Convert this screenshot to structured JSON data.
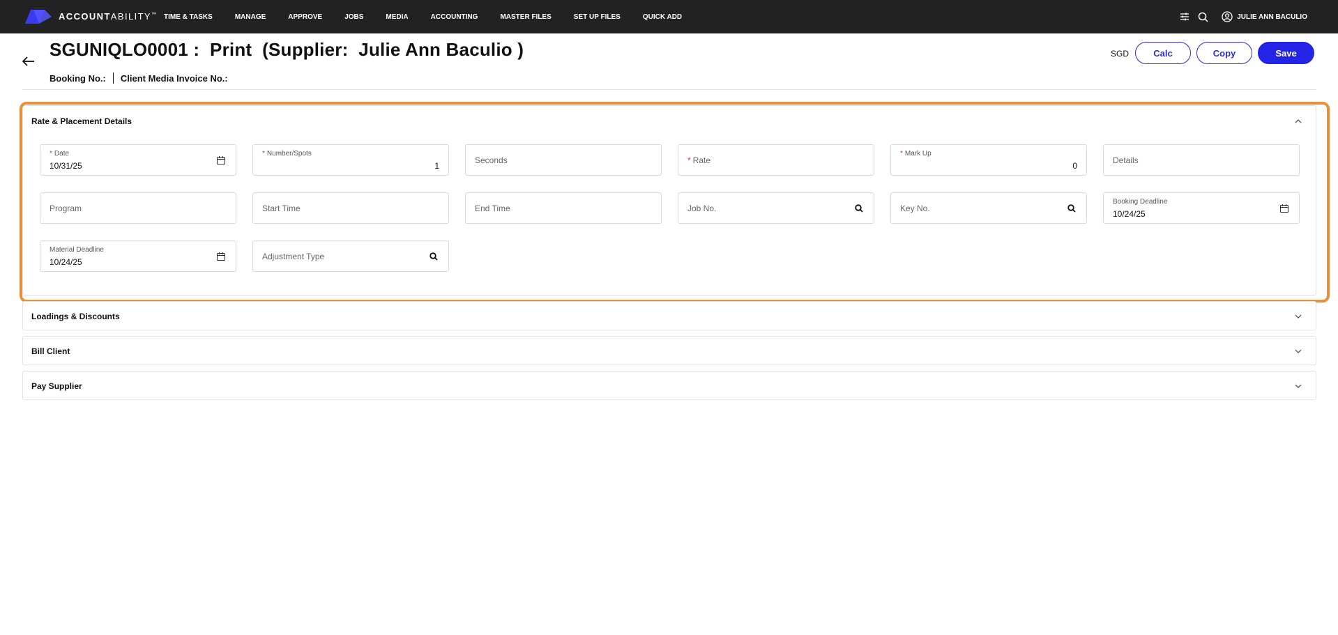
{
  "app": {
    "brand_bold": "ACCOUNT",
    "brand_light": "ABILITY",
    "brand_tm": "™",
    "nav": [
      "TIME & TASKS",
      "MANAGE",
      "APPROVE",
      "JOBS",
      "MEDIA",
      "ACCOUNTING",
      "MASTER FILES",
      "SET UP FILES",
      "QUICK ADD"
    ],
    "user_name": "JULIE ANN BACULIO",
    "accent_color": "#2424e6",
    "topbar_color": "#222222"
  },
  "header": {
    "title": "SGUNIQLO0001 :  Print  (Supplier:  Julie Ann Baculio )",
    "booking_no_label": "Booking No.:",
    "client_invoice_label": "Client Media Invoice No.:",
    "currency": "SGD",
    "calc_label": "Calc",
    "copy_label": "Copy",
    "save_label": "Save"
  },
  "highlight_color": "#e8913a",
  "rate_section": {
    "title": "Rate & Placement Details",
    "expanded": true,
    "fields": {
      "date": {
        "label": "Date",
        "required": "*",
        "value": "10/31/25",
        "icon": "calendar-icon"
      },
      "number_spots": {
        "label": "Number/Spots",
        "required": "*",
        "value": "1"
      },
      "seconds": {
        "placeholder": "Seconds"
      },
      "rate": {
        "placeholder": "Rate",
        "required": "*"
      },
      "mark_up": {
        "label": "Mark Up",
        "required": "*",
        "value": "0"
      },
      "details": {
        "placeholder": "Details"
      },
      "program": {
        "placeholder": "Program"
      },
      "start_time": {
        "placeholder": "Start Time"
      },
      "end_time": {
        "placeholder": "End Time"
      },
      "job_no": {
        "placeholder": "Job No.",
        "icon": "search-icon"
      },
      "key_no": {
        "placeholder": "Key No.",
        "icon": "search-icon"
      },
      "booking_deadline": {
        "label": "Booking Deadline",
        "value": "10/24/25",
        "icon": "calendar-icon"
      },
      "material_deadline": {
        "label": "Material Deadline",
        "value": "10/24/25",
        "icon": "calendar-icon"
      },
      "adjustment_type": {
        "placeholder": "Adjustment Type",
        "icon": "search-icon"
      }
    }
  },
  "sections": {
    "loadings": {
      "title": "Loadings & Discounts",
      "expanded": false
    },
    "bill_client": {
      "title": "Bill Client",
      "expanded": false
    },
    "pay_supplier": {
      "title": "Pay Supplier",
      "expanded": false
    }
  }
}
